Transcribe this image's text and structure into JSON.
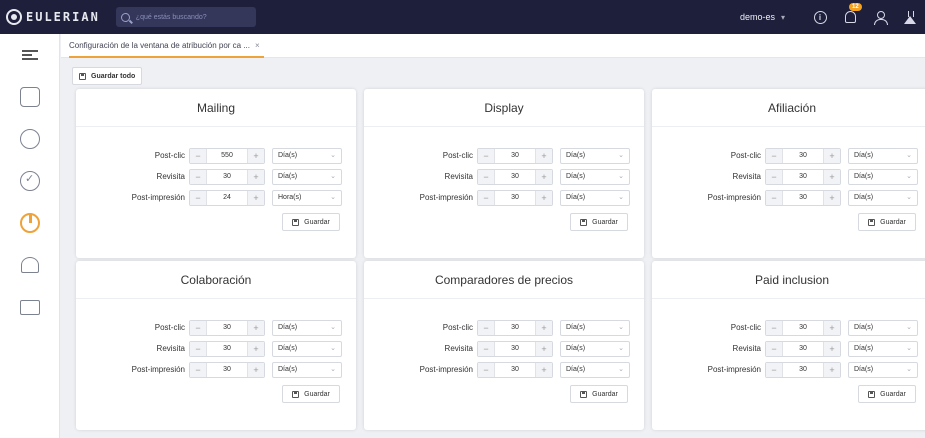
{
  "app": {
    "logo_text": "EULERIAN",
    "search_placeholder": "¿qué estás buscando?",
    "account": "demo-es",
    "notification_count": "12"
  },
  "tabs": [
    {
      "label": "Configuración de la ventana de atribución por ca ...",
      "close": "×"
    }
  ],
  "toolbar": {
    "save_all_label": "Guardar todo"
  },
  "cards": [
    {
      "title": "Mailing",
      "rows": [
        {
          "label": "Post-clic",
          "value": "550",
          "unit": "Día(s)"
        },
        {
          "label": "Revisita",
          "value": "30",
          "unit": "Día(s)"
        },
        {
          "label": "Post-impresión",
          "value": "24",
          "unit": "Hora(s)"
        }
      ],
      "save_label": "Guardar"
    },
    {
      "title": "Display",
      "rows": [
        {
          "label": "Post-clic",
          "value": "30",
          "unit": "Día(s)"
        },
        {
          "label": "Revisita",
          "value": "30",
          "unit": "Día(s)"
        },
        {
          "label": "Post-impresión",
          "value": "30",
          "unit": "Día(s)"
        }
      ],
      "save_label": "Guardar"
    },
    {
      "title": "Afiliación",
      "rows": [
        {
          "label": "Post-clic",
          "value": "30",
          "unit": "Día(s)"
        },
        {
          "label": "Revisita",
          "value": "30",
          "unit": "Día(s)"
        },
        {
          "label": "Post-impresión",
          "value": "30",
          "unit": "Día(s)"
        }
      ],
      "save_label": "Guardar"
    },
    {
      "title": "Colaboración",
      "rows": [
        {
          "label": "Post-clic",
          "value": "30",
          "unit": "Día(s)"
        },
        {
          "label": "Revisita",
          "value": "30",
          "unit": "Día(s)"
        },
        {
          "label": "Post-impresión",
          "value": "30",
          "unit": "Día(s)"
        }
      ],
      "save_label": "Guardar"
    },
    {
      "title": "Comparadores de precios",
      "rows": [
        {
          "label": "Post-clic",
          "value": "30",
          "unit": "Día(s)"
        },
        {
          "label": "Revisita",
          "value": "30",
          "unit": "Día(s)"
        },
        {
          "label": "Post-impresión",
          "value": "30",
          "unit": "Día(s)"
        }
      ],
      "save_label": "Guardar"
    },
    {
      "title": "Paid inclusion",
      "rows": [
        {
          "label": "Post-clic",
          "value": "30",
          "unit": "Día(s)"
        },
        {
          "label": "Revisita",
          "value": "30",
          "unit": "Día(s)"
        },
        {
          "label": "Post-impresión",
          "value": "30",
          "unit": "Día(s)"
        }
      ],
      "save_label": "Guardar"
    }
  ],
  "stepper_symbols": {
    "minus": "−",
    "plus": "+"
  },
  "colors": {
    "topbar": "#1d1f3b",
    "accent": "#f0a23a"
  }
}
